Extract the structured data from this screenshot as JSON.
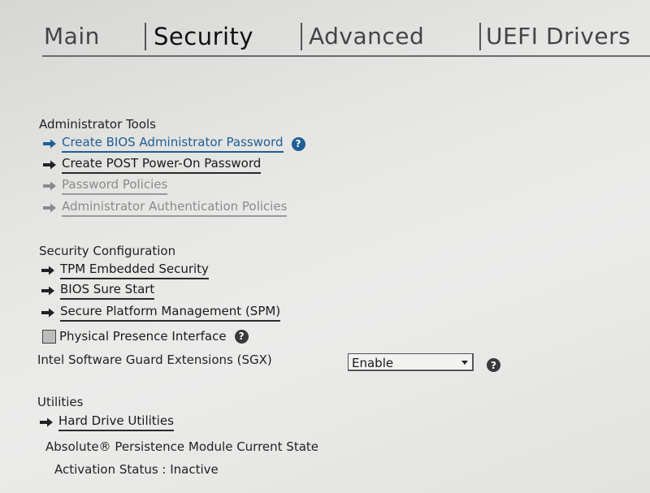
{
  "tabs": [
    {
      "label": "Main"
    },
    {
      "label": "Security"
    },
    {
      "label": "Advanced"
    },
    {
      "label": "UEFI Drivers"
    }
  ],
  "active_tab": "Security",
  "admin_tools": {
    "heading": "Administrator Tools",
    "items": [
      {
        "label": "Create BIOS Administrator Password"
      },
      {
        "label": "Create POST Power-On Password"
      },
      {
        "label": "Password Policies"
      },
      {
        "label": "Administrator Authentication Policies"
      }
    ]
  },
  "security_config": {
    "heading": "Security Configuration",
    "items": [
      {
        "label": "TPM Embedded Security"
      },
      {
        "label": "BIOS Sure Start"
      },
      {
        "label": "Secure Platform Management (SPM)"
      }
    ],
    "ppi_label": "Physical Presence Interface",
    "ppi_checked": false,
    "sgx_label": "Intel Software Guard Extensions (SGX)",
    "sgx_value": "Enable"
  },
  "utilities": {
    "heading": "Utilities",
    "items": [
      {
        "label": "Hard Drive Utilities"
      }
    ],
    "absolute_title": "Absolute® Persistence Module Current State",
    "activation_status": "Activation Status : Inactive"
  },
  "help_glyph": "?",
  "icons": {
    "arrow": "arrow-right-icon",
    "help": "help-icon",
    "dropdown": "chevron-down-icon"
  },
  "colors": {
    "link_highlight": "#1f5e96",
    "disabled": "#8a8a8a",
    "background": "#e8e8e6"
  }
}
